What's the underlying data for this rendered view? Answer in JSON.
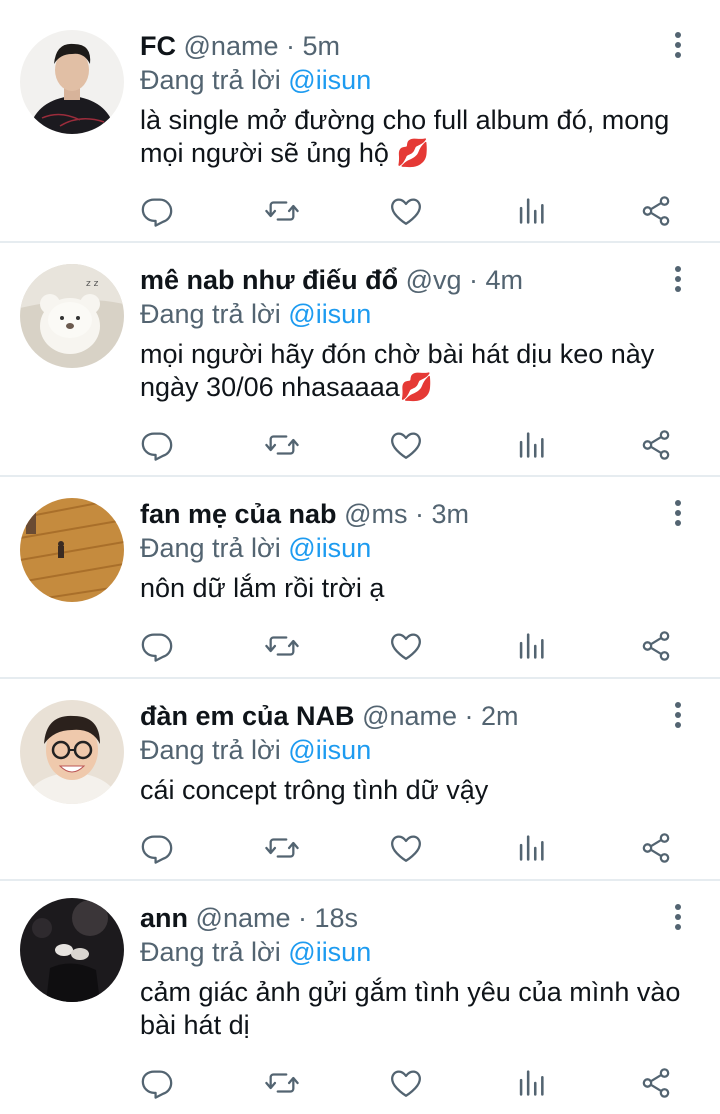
{
  "tweets": [
    {
      "name": "FC",
      "handle": "@name",
      "time": "5m",
      "reply_prefix": "Đang trả lời",
      "reply_to": "@iisun",
      "text": "là single mở đường cho full album đó, mong mọi người sẽ ủng hộ 💋",
      "avatar": "avatar-man-black-shirt"
    },
    {
      "name": "mê nab như điếu đổ",
      "handle": "@vg",
      "time": "4m",
      "reply_prefix": "Đang trả lời",
      "reply_to": "@iisun",
      "text": "mọi người hãy đón chờ bài hát dịu keo này ngày 30/06 nhasaaaa💋",
      "avatar": "avatar-teddy-bear"
    },
    {
      "name": "fan mẹ của nab",
      "handle": "@ms",
      "time": "3m",
      "reply_prefix": "Đang trả lời",
      "reply_to": "@iisun",
      "text": "nôn dữ lắm rồi trời ạ",
      "avatar": "avatar-wooden-floor"
    },
    {
      "name": "đàn em của NAB",
      "handle": "@name",
      "time": "2m",
      "reply_prefix": "Đang trả lời",
      "reply_to": "@iisun",
      "text": "cái concept trông tình dữ vậy",
      "avatar": "avatar-smiling-glasses"
    },
    {
      "name": "ann",
      "handle": "@name",
      "time": "18s",
      "reply_prefix": "Đang trả lời",
      "reply_to": "@iisun",
      "text": "cảm giác ảnh gửi gắm tình yêu của mình vào bài hát dị",
      "avatar": "avatar-dark-night"
    }
  ],
  "icons": {
    "reply": "reply-icon",
    "retweet": "retweet-icon",
    "like": "heart-icon",
    "stats": "stats-icon",
    "share": "share-icon",
    "more": "more-vertical-icon"
  },
  "colors": {
    "text": "#0f1419",
    "secondary": "#536471",
    "mention": "#1d9bf0",
    "divider": "#e6ecf0"
  }
}
